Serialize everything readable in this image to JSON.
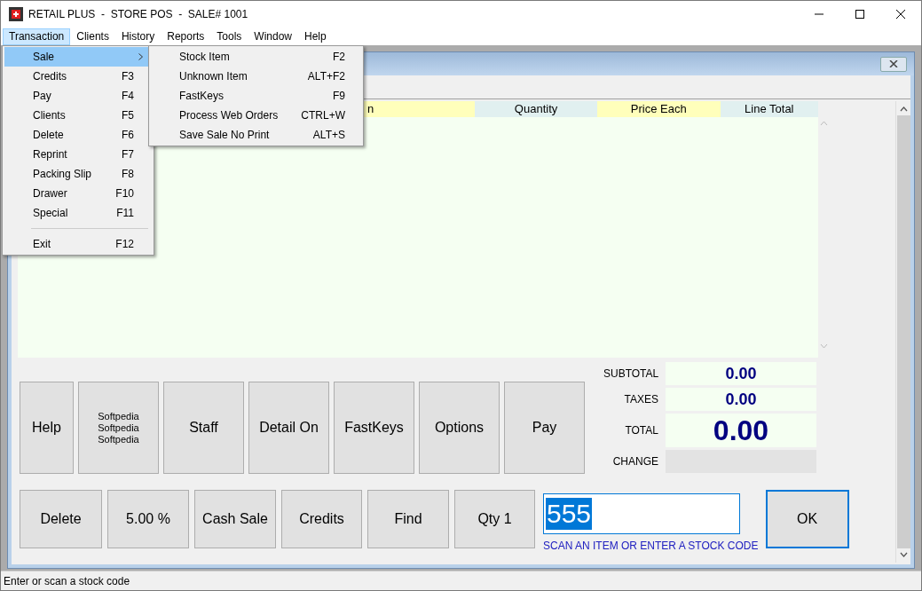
{
  "window": {
    "title": "RETAIL PLUS  -  STORE POS  -  SALE# 1001"
  },
  "menu_bar": [
    {
      "label": "Transaction",
      "selected": true
    },
    {
      "label": "Clients",
      "selected": false
    },
    {
      "label": "History",
      "selected": false
    },
    {
      "label": "Reports",
      "selected": false
    },
    {
      "label": "Tools",
      "selected": false
    },
    {
      "label": "Window",
      "selected": false
    },
    {
      "label": "Help",
      "selected": false
    }
  ],
  "open_menu": [
    {
      "kind": "submenu",
      "label": "Sale",
      "selected": true
    },
    {
      "kind": "item",
      "label": "Credits",
      "shortcut": "F3",
      "selected": false
    },
    {
      "kind": "item",
      "label": "Pay",
      "shortcut": "F4",
      "selected": false
    },
    {
      "kind": "item",
      "label": "Clients",
      "shortcut": "F5",
      "selected": false
    },
    {
      "kind": "item",
      "label": "Delete",
      "shortcut": "F6",
      "selected": false
    },
    {
      "kind": "item",
      "label": "Reprint",
      "shortcut": "F7",
      "selected": false
    },
    {
      "kind": "item",
      "label": "Packing Slip",
      "shortcut": "F8",
      "selected": false
    },
    {
      "kind": "item",
      "label": "Drawer",
      "shortcut": "F10",
      "selected": false
    },
    {
      "kind": "item",
      "label": "Special",
      "shortcut": "F11",
      "selected": false
    },
    {
      "kind": "separator"
    },
    {
      "kind": "item",
      "label": "Exit",
      "shortcut": "F12",
      "selected": false
    }
  ],
  "submenu": [
    {
      "label": "Stock Item",
      "shortcut": "F2"
    },
    {
      "label": "Unknown Item",
      "shortcut": "ALT+F2"
    },
    {
      "label": "FastKeys",
      "shortcut": "F9"
    },
    {
      "label": "Process Web Orders",
      "shortcut": "CTRL+W"
    },
    {
      "label": "Save Sale No Print",
      "shortcut": "ALT+S"
    }
  ],
  "grid": {
    "columns": [
      {
        "label": "n"
      },
      {
        "label": "Quantity"
      },
      {
        "label": "Price Each"
      },
      {
        "label": "Line Total"
      }
    ]
  },
  "buttons_row_1": [
    {
      "label": "Help",
      "kind": "normal"
    },
    {
      "label": "Softpedia\nSoftpedia\nSoftpedia",
      "kind": "small"
    },
    {
      "label": "Staff",
      "kind": "normal"
    },
    {
      "label": "Detail On",
      "kind": "normal"
    },
    {
      "label": "FastKeys",
      "kind": "normal"
    },
    {
      "label": "Options",
      "kind": "normal"
    },
    {
      "label": "Pay",
      "kind": "normal"
    }
  ],
  "totals": [
    {
      "label": "SUBTOTAL",
      "value": "0.00",
      "kind": "normal"
    },
    {
      "label": "TAXES",
      "value": "0.00",
      "kind": "normal"
    },
    {
      "label": "TOTAL",
      "value": "0.00",
      "kind": "large"
    },
    {
      "label": "CHANGE",
      "kind": "empty"
    }
  ],
  "buttons_row_2": [
    "Delete",
    "5.00 %",
    "Cash Sale",
    "Credits",
    "Find",
    "Qty 1"
  ],
  "scan": {
    "value": "555",
    "hint": "SCAN AN ITEM OR ENTER A STOCK CODE"
  },
  "ok_button": "OK",
  "status_bar": "Enter or scan a stock code"
}
